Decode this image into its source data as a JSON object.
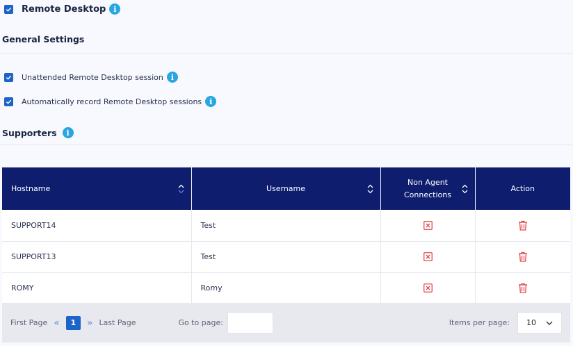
{
  "remote_desktop": {
    "label": "Remote Desktop",
    "checked": true,
    "icon": "info-icon"
  },
  "general_settings": {
    "title": "General Settings",
    "options": [
      {
        "label": "Unattended Remote Desktop session",
        "checked": true
      },
      {
        "label": "Automatically record Remote Desktop sessions",
        "checked": true
      }
    ]
  },
  "supporters": {
    "title": "Supporters",
    "columns": {
      "hostname": "Hostname",
      "username": "Username",
      "non_agent_line1": "Non Agent",
      "non_agent_line2": "Connections",
      "action": "Action"
    },
    "rows": [
      {
        "hostname": "SUPPORT14",
        "username": "Test"
      },
      {
        "hostname": "SUPPORT13",
        "username": "Test"
      },
      {
        "hostname": "ROMY",
        "username": "Romy"
      }
    ]
  },
  "pagination": {
    "first_page": "First Page",
    "current_page": "1",
    "last_page": "Last Page",
    "goto_label": "Go to page:",
    "goto_value": "",
    "items_per_page_label": "Items per page:",
    "items_per_page_value": "10"
  },
  "colors": {
    "header_bg": "#0f1d6e",
    "accent": "#1c64c8",
    "info": "#29a6e0",
    "danger": "#e0474c"
  }
}
